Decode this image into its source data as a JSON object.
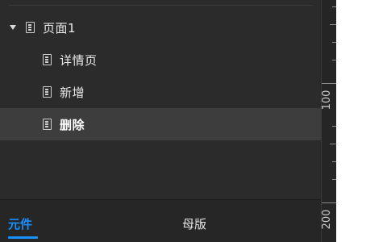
{
  "tree": {
    "root": {
      "label": "页面1",
      "icon": "document-icon",
      "expanded": true
    },
    "children": [
      {
        "label": "详情页",
        "icon": "document-icon"
      },
      {
        "label": "新增",
        "icon": "document-icon"
      },
      {
        "label": "删除",
        "icon": "document-icon",
        "selected": true
      }
    ]
  },
  "tabs": {
    "components_label": "元件",
    "masters_label": "母版",
    "active": "components"
  },
  "ruler": {
    "label_100": "100",
    "label_200": "200"
  },
  "colors": {
    "accent": "#1890ff",
    "panel_bg": "#2b2b2b",
    "selected_bg": "#3d3d3d",
    "canvas_bg": "#ffffff"
  }
}
